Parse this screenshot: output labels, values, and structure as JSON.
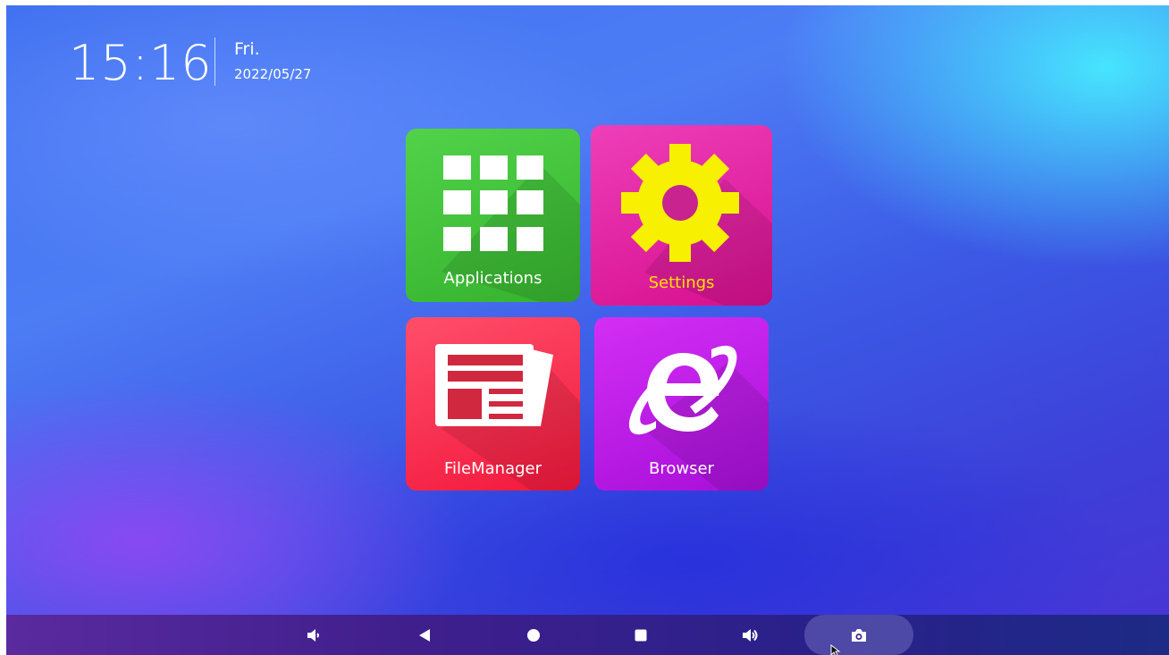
{
  "status": {
    "time": "15:16",
    "day": "Fri.",
    "date": "2022/05/27"
  },
  "tiles": [
    {
      "label": "Applications",
      "icon": "grid-icon",
      "color": "#3fc239",
      "label_color": "#ffffff"
    },
    {
      "label": "Settings",
      "icon": "gear-icon",
      "color": "#e41fa3",
      "label_color": "#ffe100"
    },
    {
      "label": "FileManager",
      "icon": "newspaper-icon",
      "color": "#f82f4f",
      "label_color": "#ffffff"
    },
    {
      "label": "Browser",
      "icon": "internet-explorer-icon",
      "color": "#bd1fe8",
      "label_color": "#ffffff"
    }
  ],
  "taskbar": {
    "buttons": [
      {
        "name": "volume-down",
        "icon": "volume-down-icon"
      },
      {
        "name": "back",
        "icon": "back-triangle-icon"
      },
      {
        "name": "home",
        "icon": "home-circle-icon"
      },
      {
        "name": "recents",
        "icon": "recents-square-icon"
      },
      {
        "name": "volume-up",
        "icon": "volume-up-icon"
      },
      {
        "name": "screenshot",
        "icon": "camera-icon"
      }
    ]
  },
  "colors": {
    "accent_cyan": "#46ebff",
    "taskbar": "#3f1f8c",
    "settings_label": "#ffe100"
  }
}
